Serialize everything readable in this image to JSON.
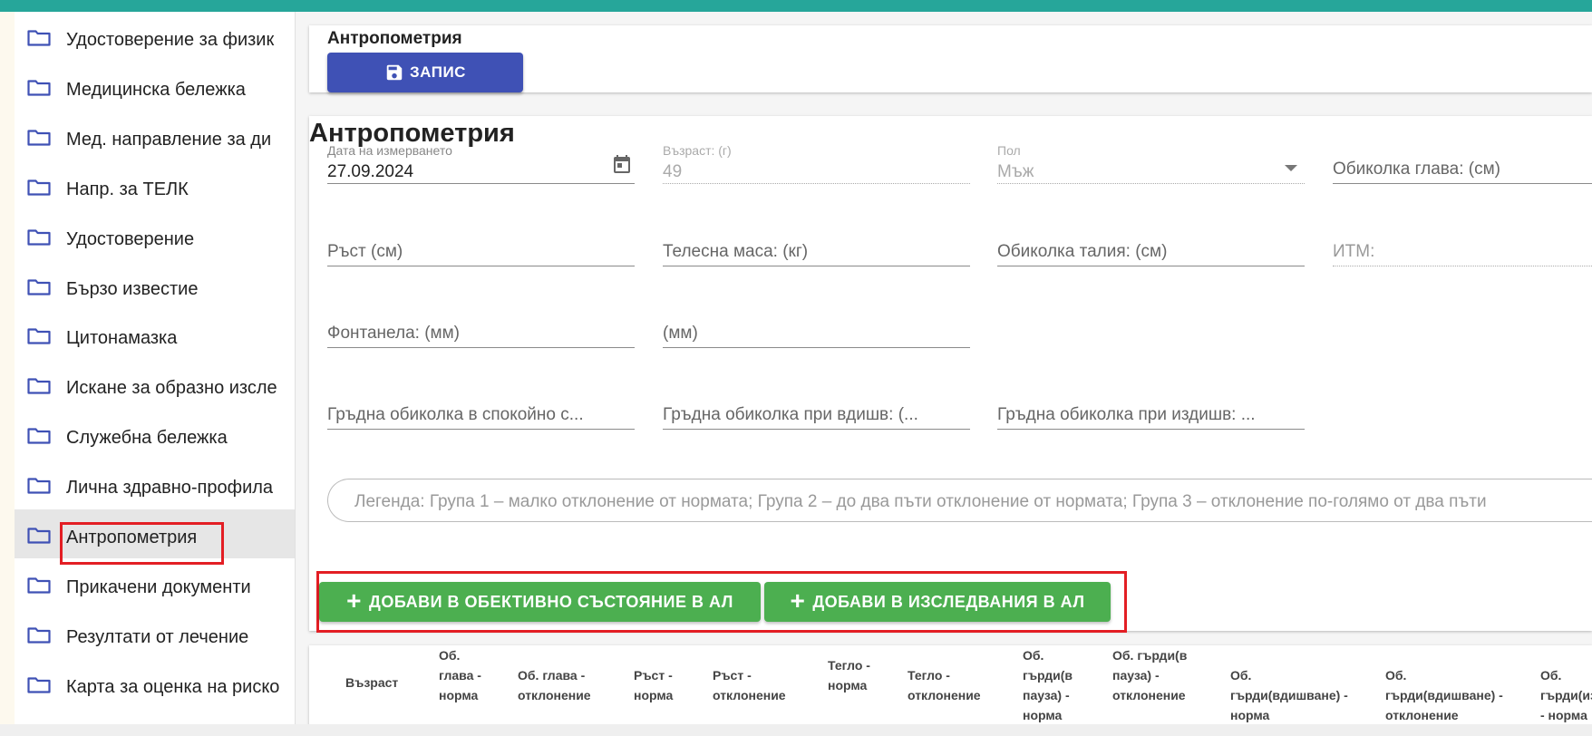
{
  "sidebar": {
    "items": [
      {
        "label": "Удостоверение за физик"
      },
      {
        "label": "Медицинска бележка"
      },
      {
        "label": "Мед. направление за ди"
      },
      {
        "label": "Напр. за ТЕЛК"
      },
      {
        "label": "Удостоверение"
      },
      {
        "label": "Бързо известие"
      },
      {
        "label": "Цитонамазка"
      },
      {
        "label": "Искане за образно изсле"
      },
      {
        "label": "Служебна бележка"
      },
      {
        "label": "Лична здравно-профила"
      },
      {
        "label": "Антропометрия",
        "active": true
      },
      {
        "label": "Прикачени документи"
      },
      {
        "label": "Резултати от лечение"
      },
      {
        "label": "Карта за оценка на риско"
      }
    ],
    "icon": "folder-icon",
    "icon_color": "#3f51b5"
  },
  "header": {
    "title": "Антропометрия",
    "save_label": "ЗАПИС",
    "save_icon": "save-icon",
    "save_color": "#3f51b5"
  },
  "form": {
    "title": "Антропометрия",
    "date": {
      "label": "Дата на измерването",
      "value": "27.09.2024",
      "icon": "calendar-icon"
    },
    "age": {
      "label": "Възраст: (г)",
      "value": "49"
    },
    "sex": {
      "label": "Пол",
      "value": "Мъж"
    },
    "head_circ": {
      "label": "Обиколка глава: (см)"
    },
    "height": {
      "label": "Ръст (см)"
    },
    "weight": {
      "label": "Телесна маса: (кг)"
    },
    "waist": {
      "label": "Обиколка талия: (см)"
    },
    "bmi": {
      "label": "ИТМ:"
    },
    "fontanelle": {
      "label": "Фонтанела: (мм)"
    },
    "fontanelle2": {
      "label": "(мм)"
    },
    "chest_rest": {
      "label": "Гръдна обиколка в спокойно с..."
    },
    "chest_in": {
      "label": "Гръдна обиколка при вдишв: (..."
    },
    "chest_out": {
      "label": "Гръдна обиколка при издишв: ..."
    },
    "legend": "Легенда: Група 1 – малко отклонение от нормата; Група 2 – до два пъти отклонение от нормата; Група 3 – отклонение по-голямо от два пъти"
  },
  "actions": {
    "add_objective": "ДОБАВИ В ОБЕКТИВНО СЪСТОЯНИЕ В АЛ",
    "add_research": "ДОБАВИ В ИЗСЛЕДВАНИЯ В АЛ",
    "color": "#4caf50"
  },
  "table": {
    "headers": [
      "Възраст",
      "Об. глава - норма",
      "Об. глава - отклонение",
      "Ръст - норма",
      "Ръст - отклонение",
      "Тегло - норма",
      "Тегло - отклонение",
      "Об. гърди(в пауза) - норма",
      "Об. гърди(в пауза) - отклонение",
      "Об. гърди(вдишване) - норма",
      "Об. гърди(вдишване) - отклонение",
      "Об. гърди(издишване) - норма"
    ]
  },
  "theme": {
    "topbar": "#26a69a",
    "highlight": "#e31e24"
  }
}
